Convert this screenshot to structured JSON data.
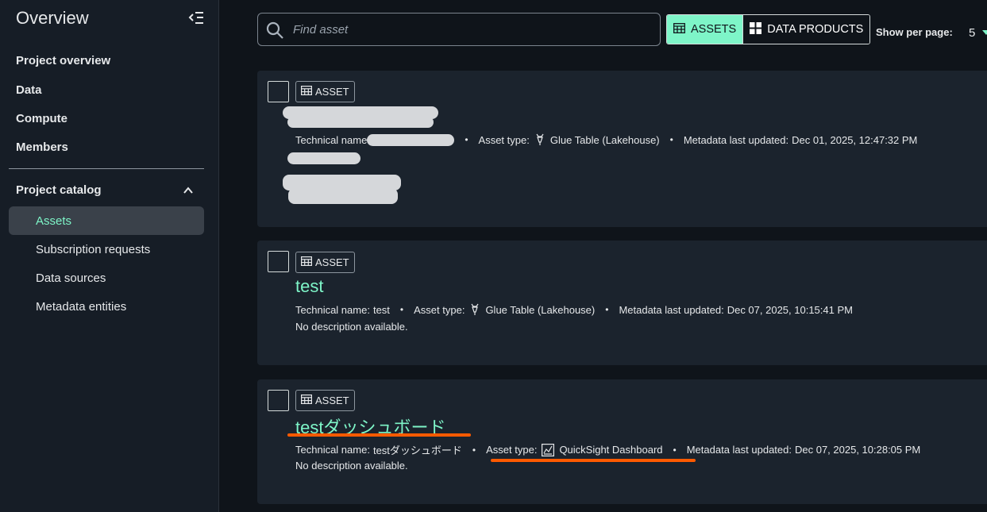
{
  "sidebar": {
    "title": "Overview",
    "items": [
      {
        "label": "Project overview"
      },
      {
        "label": "Data"
      },
      {
        "label": "Compute"
      },
      {
        "label": "Members"
      }
    ],
    "section": {
      "label": "Project catalog",
      "expanded": true,
      "items": [
        {
          "label": "Assets",
          "active": true
        },
        {
          "label": "Subscription requests"
        },
        {
          "label": "Data sources"
        },
        {
          "label": "Metadata entities"
        }
      ]
    }
  },
  "toolbar": {
    "search_placeholder": "Find asset",
    "search_value": "",
    "tabs": [
      {
        "label": "ASSETS",
        "icon": "table-icon",
        "selected": true
      },
      {
        "label": "DATA PRODUCTS",
        "icon": "grid-icon",
        "selected": false
      }
    ],
    "per_page_label": "Show per page:",
    "per_page_value": "5"
  },
  "assets": [
    {
      "badge": "ASSET",
      "title": "",
      "technical_name_label": "Technical name",
      "technical_name": "",
      "asset_type_label": "Asset type:",
      "asset_type": "Glue Table (Lakehouse)",
      "asset_type_icon": "glue-icon",
      "updated_label": "Metadata last updated:",
      "updated": "Dec 01, 2025, 12:47:32 PM",
      "redacted": true
    },
    {
      "badge": "ASSET",
      "title": "test",
      "technical_name_label": "Technical name:",
      "technical_name": "test",
      "asset_type_label": "Asset type:",
      "asset_type": "Glue Table (Lakehouse)",
      "asset_type_icon": "glue-icon",
      "updated_label": "Metadata last updated:",
      "updated": "Dec 07, 2025, 10:15:41 PM",
      "description": "No description available."
    },
    {
      "badge": "ASSET",
      "title": "testダッシュボード",
      "technical_name_label": "Technical name:",
      "technical_name": "testダッシュボード",
      "asset_type_label": "Asset type:",
      "asset_type": "QuickSight Dashboard",
      "asset_type_icon": "dashboard-icon",
      "updated_label": "Metadata last updated:",
      "updated": "Dec 07, 2025, 10:28:05 PM",
      "description": "No description available."
    }
  ],
  "colors": {
    "accent": "#7ef5c8",
    "annotation": "#ff5a00",
    "card_bg": "#1b232d",
    "sidebar_bg": "#161d26"
  }
}
